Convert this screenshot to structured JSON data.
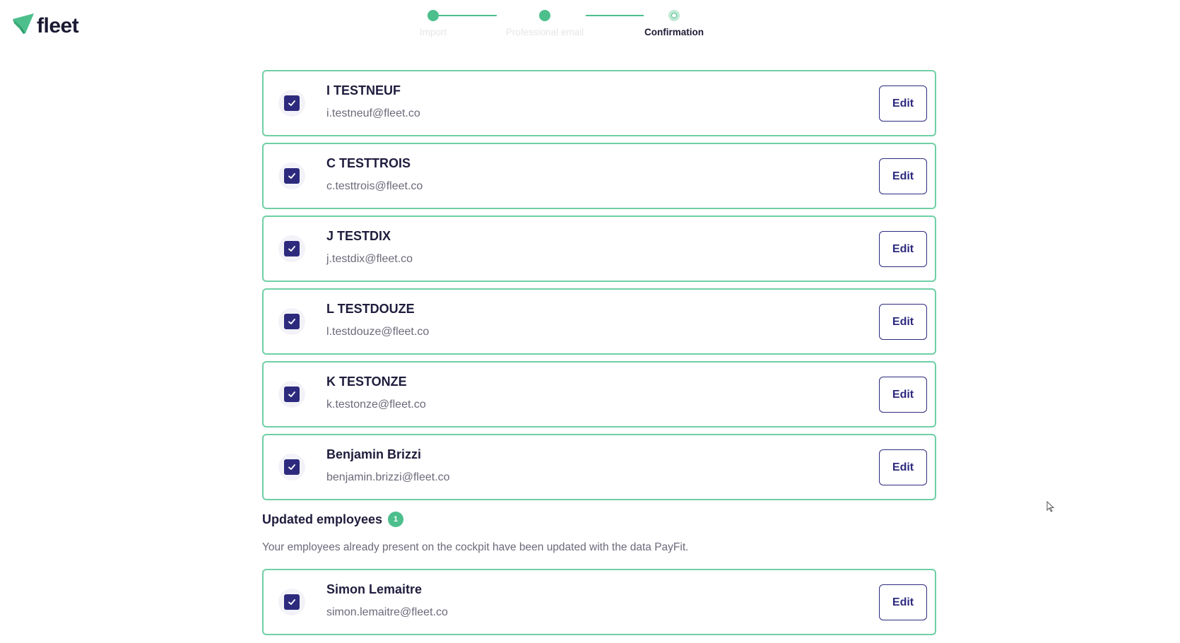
{
  "brand": {
    "name": "fleet",
    "color": "#4cbf8c"
  },
  "stepper": {
    "steps": [
      {
        "label": "Import",
        "state": "completed"
      },
      {
        "label": "Professional email",
        "state": "completed"
      },
      {
        "label": "Confirmation",
        "state": "current"
      }
    ]
  },
  "employees": [
    {
      "name": "I TESTNEUF",
      "email": "i.testneuf@fleet.co",
      "checked": true,
      "edit_label": "Edit"
    },
    {
      "name": "C TESTTROIS",
      "email": "c.testtrois@fleet.co",
      "checked": true,
      "edit_label": "Edit"
    },
    {
      "name": "J TESTDIX",
      "email": "j.testdix@fleet.co",
      "checked": true,
      "edit_label": "Edit"
    },
    {
      "name": "L TESTDOUZE",
      "email": "l.testdouze@fleet.co",
      "checked": true,
      "edit_label": "Edit"
    },
    {
      "name": "K TESTONZE",
      "email": "k.testonze@fleet.co",
      "checked": true,
      "edit_label": "Edit"
    },
    {
      "name": "Benjamin Brizzi",
      "email": "benjamin.brizzi@fleet.co",
      "checked": true,
      "edit_label": "Edit"
    }
  ],
  "updated_section": {
    "title": "Updated employees",
    "count": "1",
    "description": "Your employees already present on the cockpit have been updated with the data PayFit.",
    "employees": [
      {
        "name": "Simon Lemaitre",
        "email": "simon.lemaitre@fleet.co",
        "checked": true,
        "edit_label": "Edit"
      }
    ]
  },
  "colors": {
    "accent_green": "#4cbf8c",
    "card_border": "#6fcfa6",
    "primary_navy": "#2d2a7e",
    "text_dark": "#1f1d3d",
    "text_muted": "#6b6a7a"
  }
}
